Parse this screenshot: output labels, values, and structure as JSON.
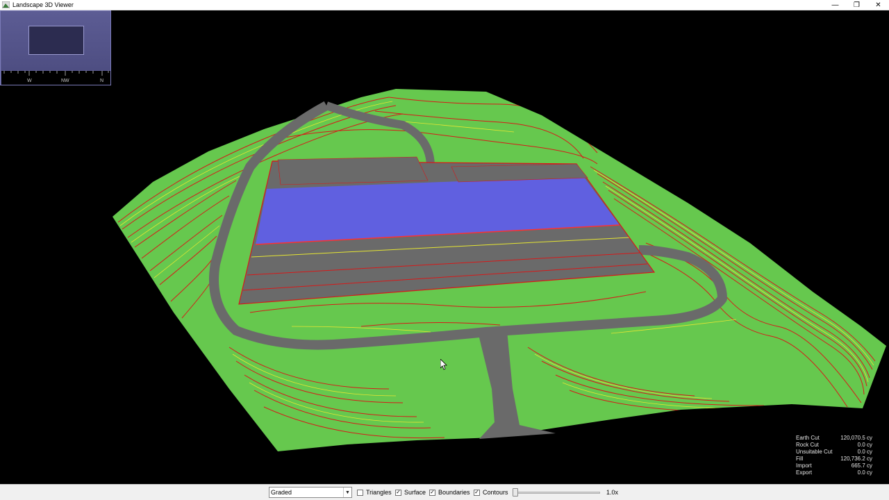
{
  "window": {
    "title": "Landscape 3D Viewer",
    "controls": [
      "minimize-icon",
      "restore-icon",
      "close-icon"
    ]
  },
  "compass": {
    "labels": [
      "W",
      "NW",
      "N"
    ]
  },
  "quantities": [
    {
      "label": "Earth Cut",
      "value": "120,070.5 cy"
    },
    {
      "label": "Rock Cut",
      "value": "0.0 cy"
    },
    {
      "label": "Unsuitable Cut",
      "value": "0.0 cy"
    },
    {
      "label": "Fill",
      "value": "120,736.2 cy"
    },
    {
      "label": "Import",
      "value": "665.7 cy"
    },
    {
      "label": "Export",
      "value": "0.0 cy"
    }
  ],
  "toolbar": {
    "mode_select": {
      "value": "Graded"
    },
    "checkboxes": [
      {
        "label": "Triangles",
        "checked": false
      },
      {
        "label": "Surface",
        "checked": true
      },
      {
        "label": "Boundaries",
        "checked": true
      },
      {
        "label": "Contours",
        "checked": true
      }
    ],
    "zoom_slider": {
      "fraction": 0.0
    },
    "zoom_label": "1.0x"
  },
  "colors": {
    "terrain": "#66c84e",
    "contour_red": "#d81818",
    "contour_yellow": "#e6e632",
    "pad": "#6060e0",
    "paving": "#6a6a6a"
  }
}
